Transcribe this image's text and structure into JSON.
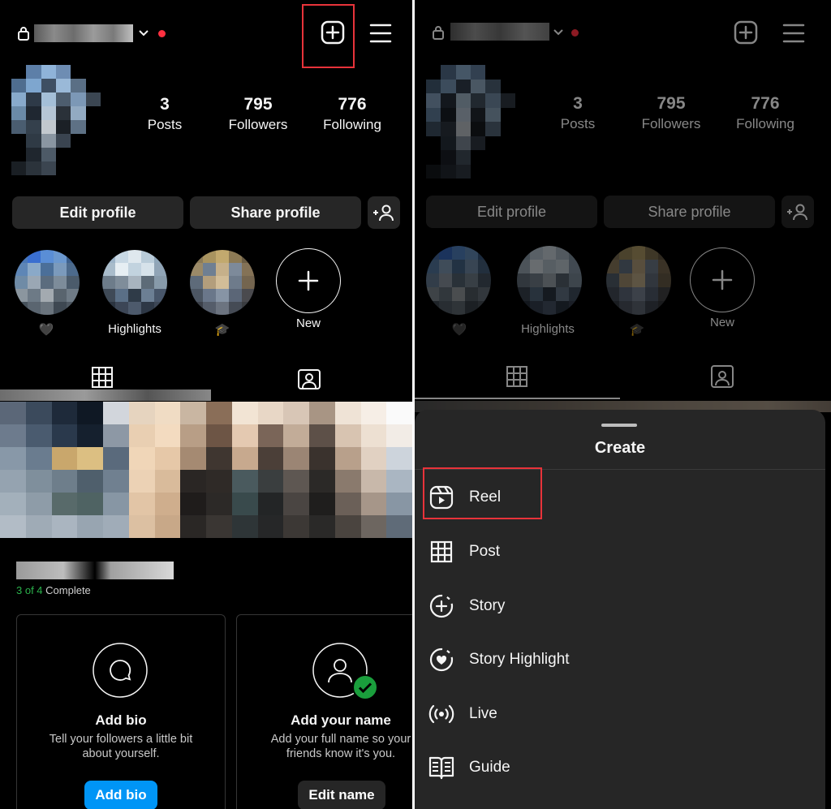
{
  "profile": {
    "stats": [
      {
        "num": "3",
        "label": "Posts"
      },
      {
        "num": "795",
        "label": "Followers"
      },
      {
        "num": "776",
        "label": "Following"
      }
    ],
    "edit_label": "Edit profile",
    "share_label": "Share profile"
  },
  "highlights": [
    {
      "label": "🖤"
    },
    {
      "label": "Highlights"
    },
    {
      "label": "🎓"
    },
    {
      "label": "New"
    }
  ],
  "completion": {
    "done": "3 of 4",
    "suffix": " Complete"
  },
  "cards": [
    {
      "title": "Add bio",
      "desc_line1": "Tell your followers a little bit",
      "desc_line2": "about yourself.",
      "button": "Add bio"
    },
    {
      "title": "Add your name",
      "desc_line1": "Add your full name so your",
      "desc_line2": "friends know it's you.",
      "button": "Edit name"
    }
  ],
  "sheet": {
    "title": "Create",
    "items": [
      {
        "label": "Reel",
        "icon": "reel-icon"
      },
      {
        "label": "Post",
        "icon": "grid-icon"
      },
      {
        "label": "Story",
        "icon": "story-add-icon"
      },
      {
        "label": "Story Highlight",
        "icon": "highlight-heart-icon"
      },
      {
        "label": "Live",
        "icon": "live-icon"
      },
      {
        "label": "Guide",
        "icon": "guide-icon"
      }
    ]
  },
  "colors": {
    "background": "#000000",
    "button": "#262626",
    "accent_blue": "#0095f6",
    "notification_red": "#ff3040",
    "complete_green": "#2bb24c",
    "highlight_box": "#e8333a"
  }
}
